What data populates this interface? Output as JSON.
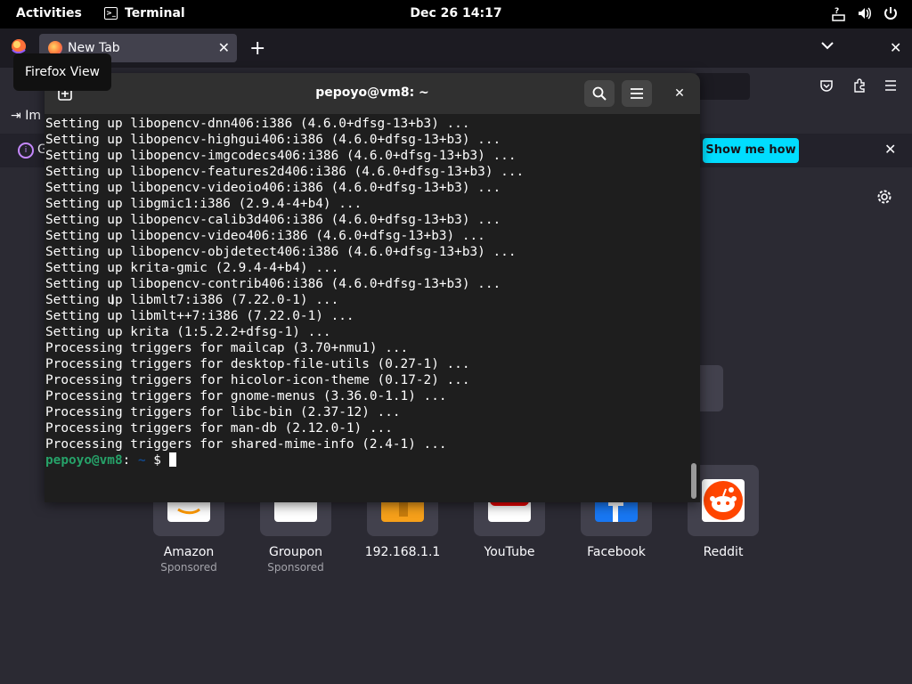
{
  "topbar": {
    "activities": "Activities",
    "app_name": "Terminal",
    "clock": "Dec 26  14:17",
    "icons": [
      "accessibility-icon",
      "volume-icon",
      "power-icon"
    ]
  },
  "firefox": {
    "tab_title": "New Tab",
    "tooltip": "Firefox View",
    "bookmark_item": "Im",
    "notice_text": "G",
    "show_me_how": "Show me how",
    "shortcuts": [
      {
        "name": "Amazon",
        "sponsored": "Sponsored",
        "color": "#ffffff"
      },
      {
        "name": "Groupon",
        "sponsored": "Sponsored",
        "color": "#ffffff"
      },
      {
        "name": "192.168.1.1",
        "sponsored": "",
        "color": "#f6a01a"
      },
      {
        "name": "YouTube",
        "sponsored": "",
        "color": "#ffffff"
      },
      {
        "name": "Facebook",
        "sponsored": "",
        "color": "#1877f2"
      },
      {
        "name": "Reddit",
        "sponsored": "",
        "color": "#ff4500"
      }
    ],
    "accent": "#00ddff"
  },
  "terminal": {
    "title": "pepoyo@vm8: ~",
    "lines": [
      "Setting up libopencv-dnn406:i386 (4.6.0+dfsg-13+b3) ...",
      "Setting up libopencv-highgui406:i386 (4.6.0+dfsg-13+b3) ...",
      "Setting up libopencv-imgcodecs406:i386 (4.6.0+dfsg-13+b3) ...",
      "Setting up libopencv-features2d406:i386 (4.6.0+dfsg-13+b3) ...",
      "Setting up libopencv-videoio406:i386 (4.6.0+dfsg-13+b3) ...",
      "Setting up libgmic1:i386 (2.9.4-4+b4) ...",
      "Setting up libopencv-calib3d406:i386 (4.6.0+dfsg-13+b3) ...",
      "Setting up libopencv-video406:i386 (4.6.0+dfsg-13+b3) ...",
      "Setting up libopencv-objdetect406:i386 (4.6.0+dfsg-13+b3) ...",
      "Setting up krita-gmic (2.9.4-4+b4) ...",
      "Setting up libopencv-contrib406:i386 (4.6.0+dfsg-13+b3) ...",
      "Setting up libmlt7:i386 (7.22.0-1) ...",
      "Setting up libmlt++7:i386 (7.22.0-1) ...",
      "Setting up krita (1:5.2.2+dfsg-1) ...",
      "Processing triggers for mailcap (3.70+nmu1) ...",
      "Processing triggers for desktop-file-utils (0.27-1) ...",
      "Processing triggers for hicolor-icon-theme (0.17-2) ...",
      "Processing triggers for gnome-menus (3.36.0-1.1) ...",
      "Processing triggers for libc-bin (2.37-12) ...",
      "Processing triggers for man-db (2.12.0-1) ...",
      "Processing triggers for shared-mime-info (2.4-1) ..."
    ],
    "prompt_user": "pepoyo@vm8",
    "prompt_sep": ":",
    "prompt_path": " ~",
    "prompt_symbol": " $ ",
    "prompt_user_color": "#26a269",
    "prompt_path_color": "#12488b"
  }
}
